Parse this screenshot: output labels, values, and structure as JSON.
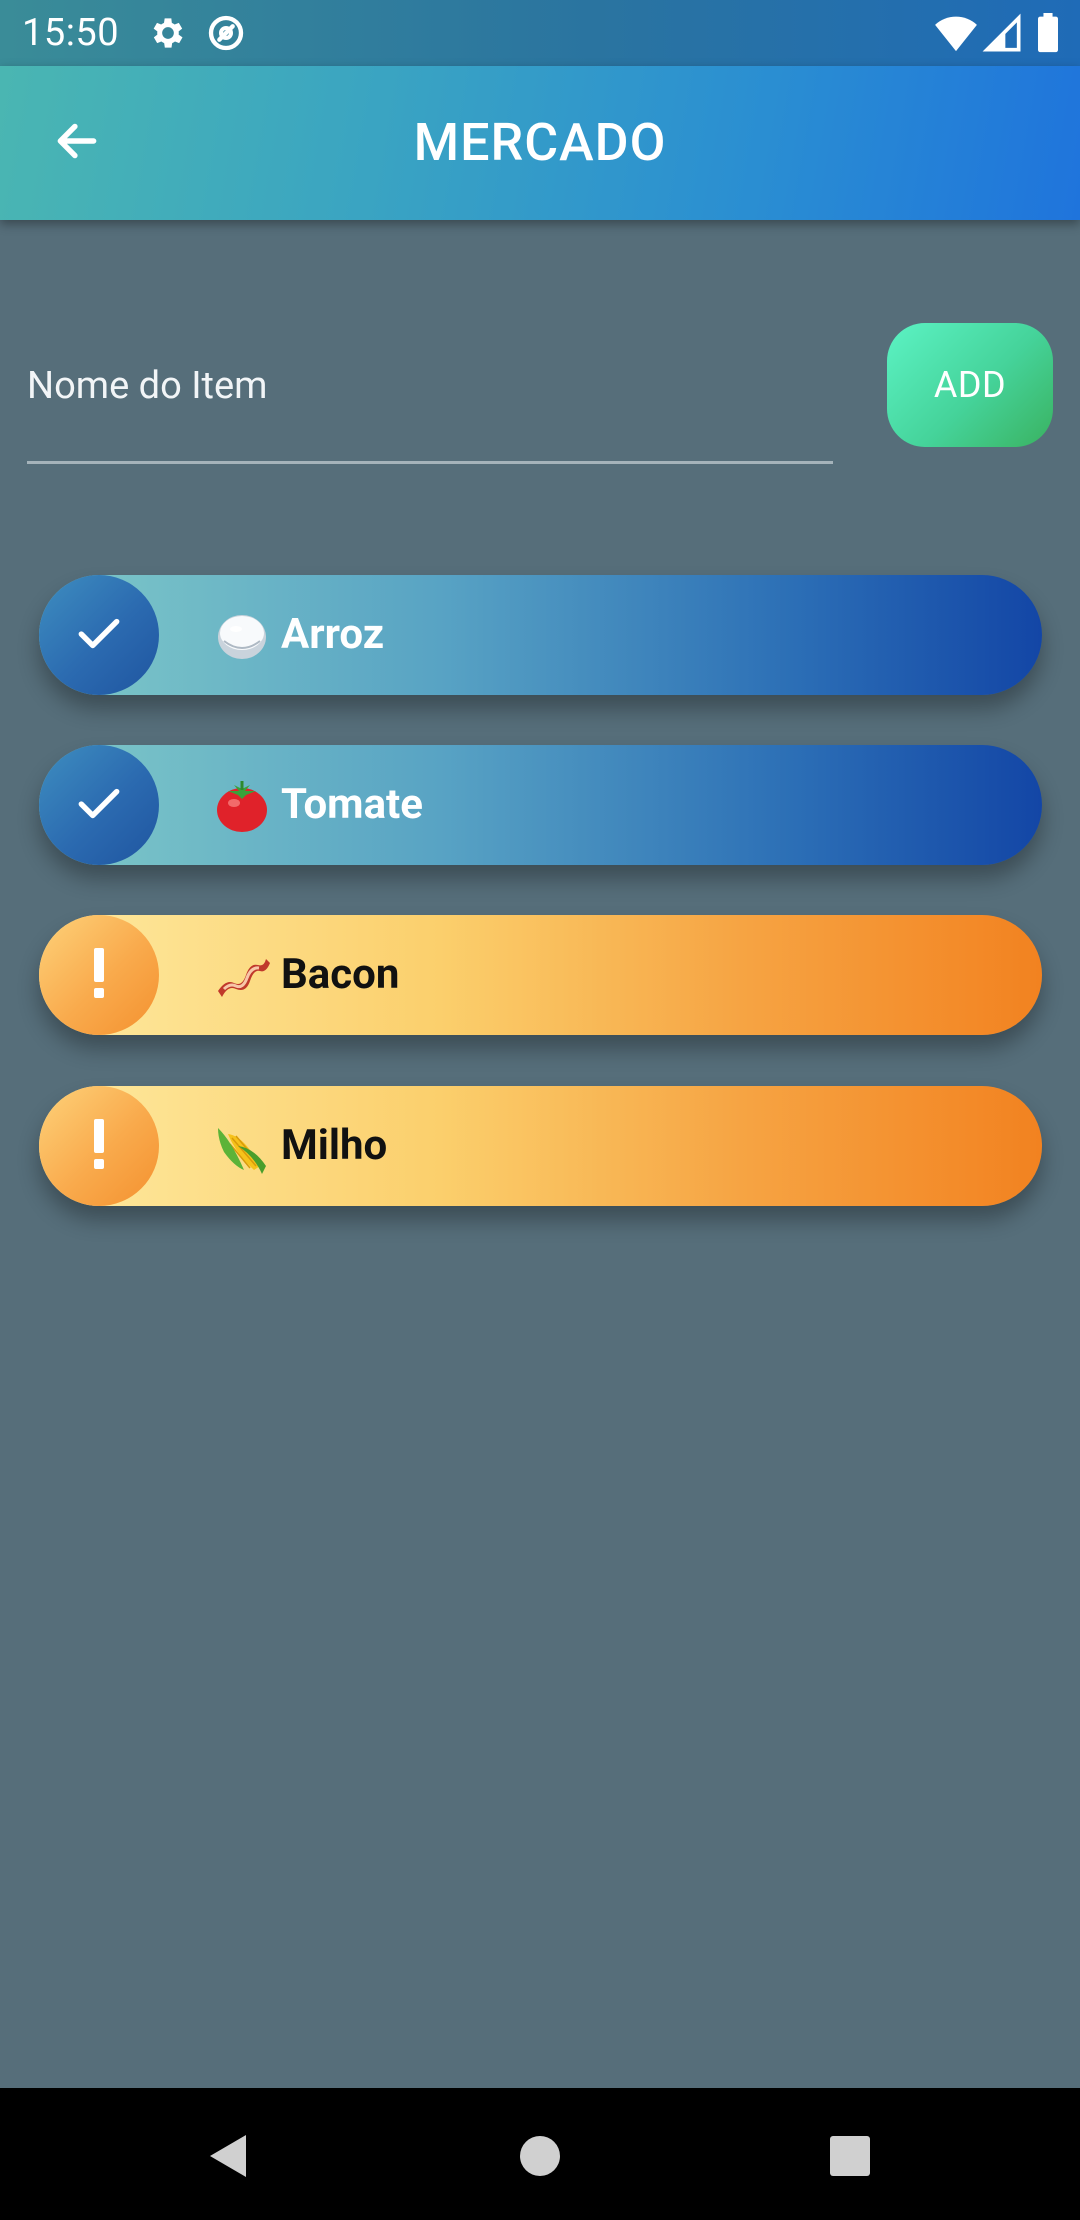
{
  "status_bar": {
    "time": "15:50",
    "icons": [
      "gear-icon",
      "sync-icon",
      "wifi-icon",
      "cell-signal-icon",
      "battery-icon"
    ]
  },
  "app_bar": {
    "title": "MERCADO",
    "back_icon": "arrow-left-icon"
  },
  "form": {
    "placeholder": "Nome do Item",
    "value": "",
    "add_label": "ADD"
  },
  "items": [
    {
      "name": "Arroz",
      "emoji": "rice-icon",
      "status": "done",
      "status_icon": "check-icon"
    },
    {
      "name": "Tomate",
      "emoji": "tomato-icon",
      "status": "done",
      "status_icon": "check-icon"
    },
    {
      "name": "Bacon",
      "emoji": "bacon-icon",
      "status": "pending",
      "status_icon": "exclamation-icon"
    },
    {
      "name": "Milho",
      "emoji": "corn-icon",
      "status": "pending",
      "status_icon": "exclamation-icon"
    }
  ],
  "nav_bar": {
    "buttons": [
      "nav-back-icon",
      "nav-home-icon",
      "nav-recents-icon"
    ]
  },
  "colors": {
    "background": "#566e7a",
    "done_gradient_start": "#7fc9c8",
    "done_gradient_end": "#1346a6",
    "pending_gradient_start": "#feeaa0",
    "pending_gradient_end": "#f28220",
    "add_button": "#45d39a"
  }
}
